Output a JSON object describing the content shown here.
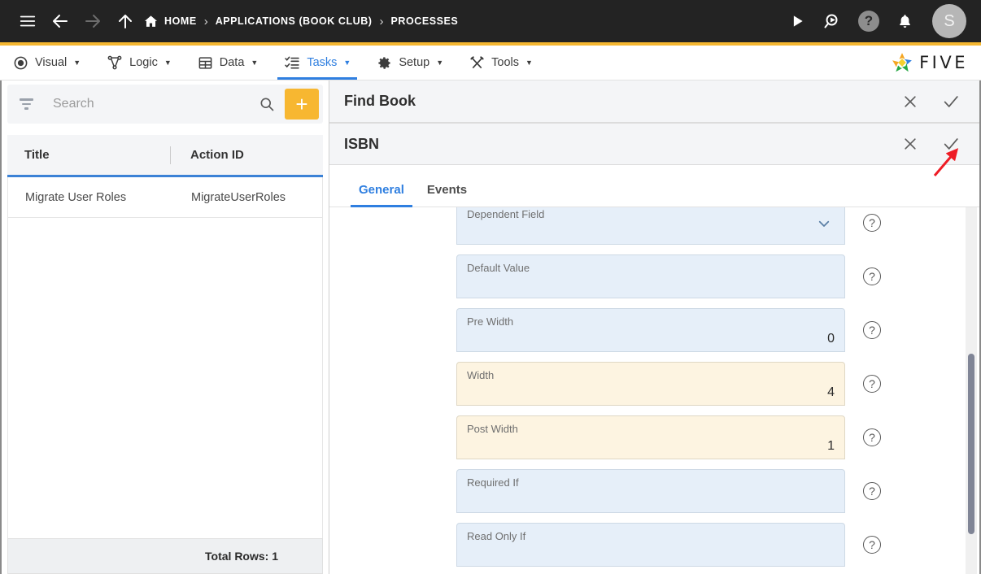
{
  "topbar": {
    "icons": [
      "menu-icon",
      "back-arrow-icon",
      "forward-arrow-icon",
      "up-arrow-icon"
    ],
    "breadcrumb": [
      {
        "label": "HOME",
        "icon": "home-icon"
      },
      {
        "label": "APPLICATIONS (BOOK CLUB)"
      },
      {
        "label": "PROCESSES"
      }
    ],
    "separator": "›",
    "right_icons": [
      "run-play-icon",
      "search-data-icon",
      "help-icon",
      "notifications-bell-icon"
    ],
    "avatar_initial": "S",
    "help_glyph": "?"
  },
  "menubar": {
    "items": [
      {
        "label": "Visual",
        "icon": "eye-icon",
        "active": false
      },
      {
        "label": "Logic",
        "icon": "logic-nodes-icon",
        "active": false
      },
      {
        "label": "Data",
        "icon": "grid-table-icon",
        "active": false
      },
      {
        "label": "Tasks",
        "icon": "tasks-list-icon",
        "active": true
      },
      {
        "label": "Setup",
        "icon": "gear-icon",
        "active": false
      },
      {
        "label": "Tools",
        "icon": "wrench-screwdriver-icon",
        "active": false
      }
    ],
    "caret": "▼",
    "brand": "FIVE"
  },
  "sidebar": {
    "search": {
      "placeholder": "Search",
      "value": "",
      "filter_icon": "filter-funnel-icon",
      "search_icon": "magnifier-icon",
      "add_label": "+"
    },
    "grid": {
      "columns": [
        "Title",
        "Action ID"
      ],
      "rows": [
        {
          "title": "Migrate User Roles",
          "action_id": "MigrateUserRoles"
        }
      ],
      "footer": "Total Rows: 1"
    }
  },
  "detail": {
    "outer_panel": {
      "title": "Find Book",
      "close_icon": "close-x-icon",
      "confirm_icon": "check-tick-icon"
    },
    "inner_panel": {
      "title": "ISBN",
      "close_icon": "close-x-icon",
      "confirm_icon": "check-tick-icon"
    },
    "tabs": [
      {
        "label": "General",
        "active": true
      },
      {
        "label": "Events",
        "active": false
      }
    ],
    "fields": [
      {
        "label": "Dependent Field",
        "value": "",
        "type": "select",
        "modified": false,
        "chevron": "chevron-down-icon"
      },
      {
        "label": "Default Value",
        "value": "",
        "type": "text",
        "modified": false
      },
      {
        "label": "Pre Width",
        "value": "0",
        "type": "text",
        "modified": false
      },
      {
        "label": "Width",
        "value": "4",
        "type": "text",
        "modified": true
      },
      {
        "label": "Post Width",
        "value": "1",
        "type": "text",
        "modified": true
      },
      {
        "label": "Required If",
        "value": "",
        "type": "text",
        "modified": false
      },
      {
        "label": "Read Only If",
        "value": "",
        "type": "text",
        "modified": false
      }
    ],
    "help_glyph": "?",
    "annotation": {
      "type": "red-arrow",
      "points_to": "check-tick-icon"
    }
  },
  "colors": {
    "header_bg": "#232323",
    "accent_orange": "#f5b731",
    "active_blue": "#2f7fe0",
    "field_blue": "#e6eff9",
    "field_modified": "#fdf4e1",
    "annotation_red": "#ee1c25"
  }
}
